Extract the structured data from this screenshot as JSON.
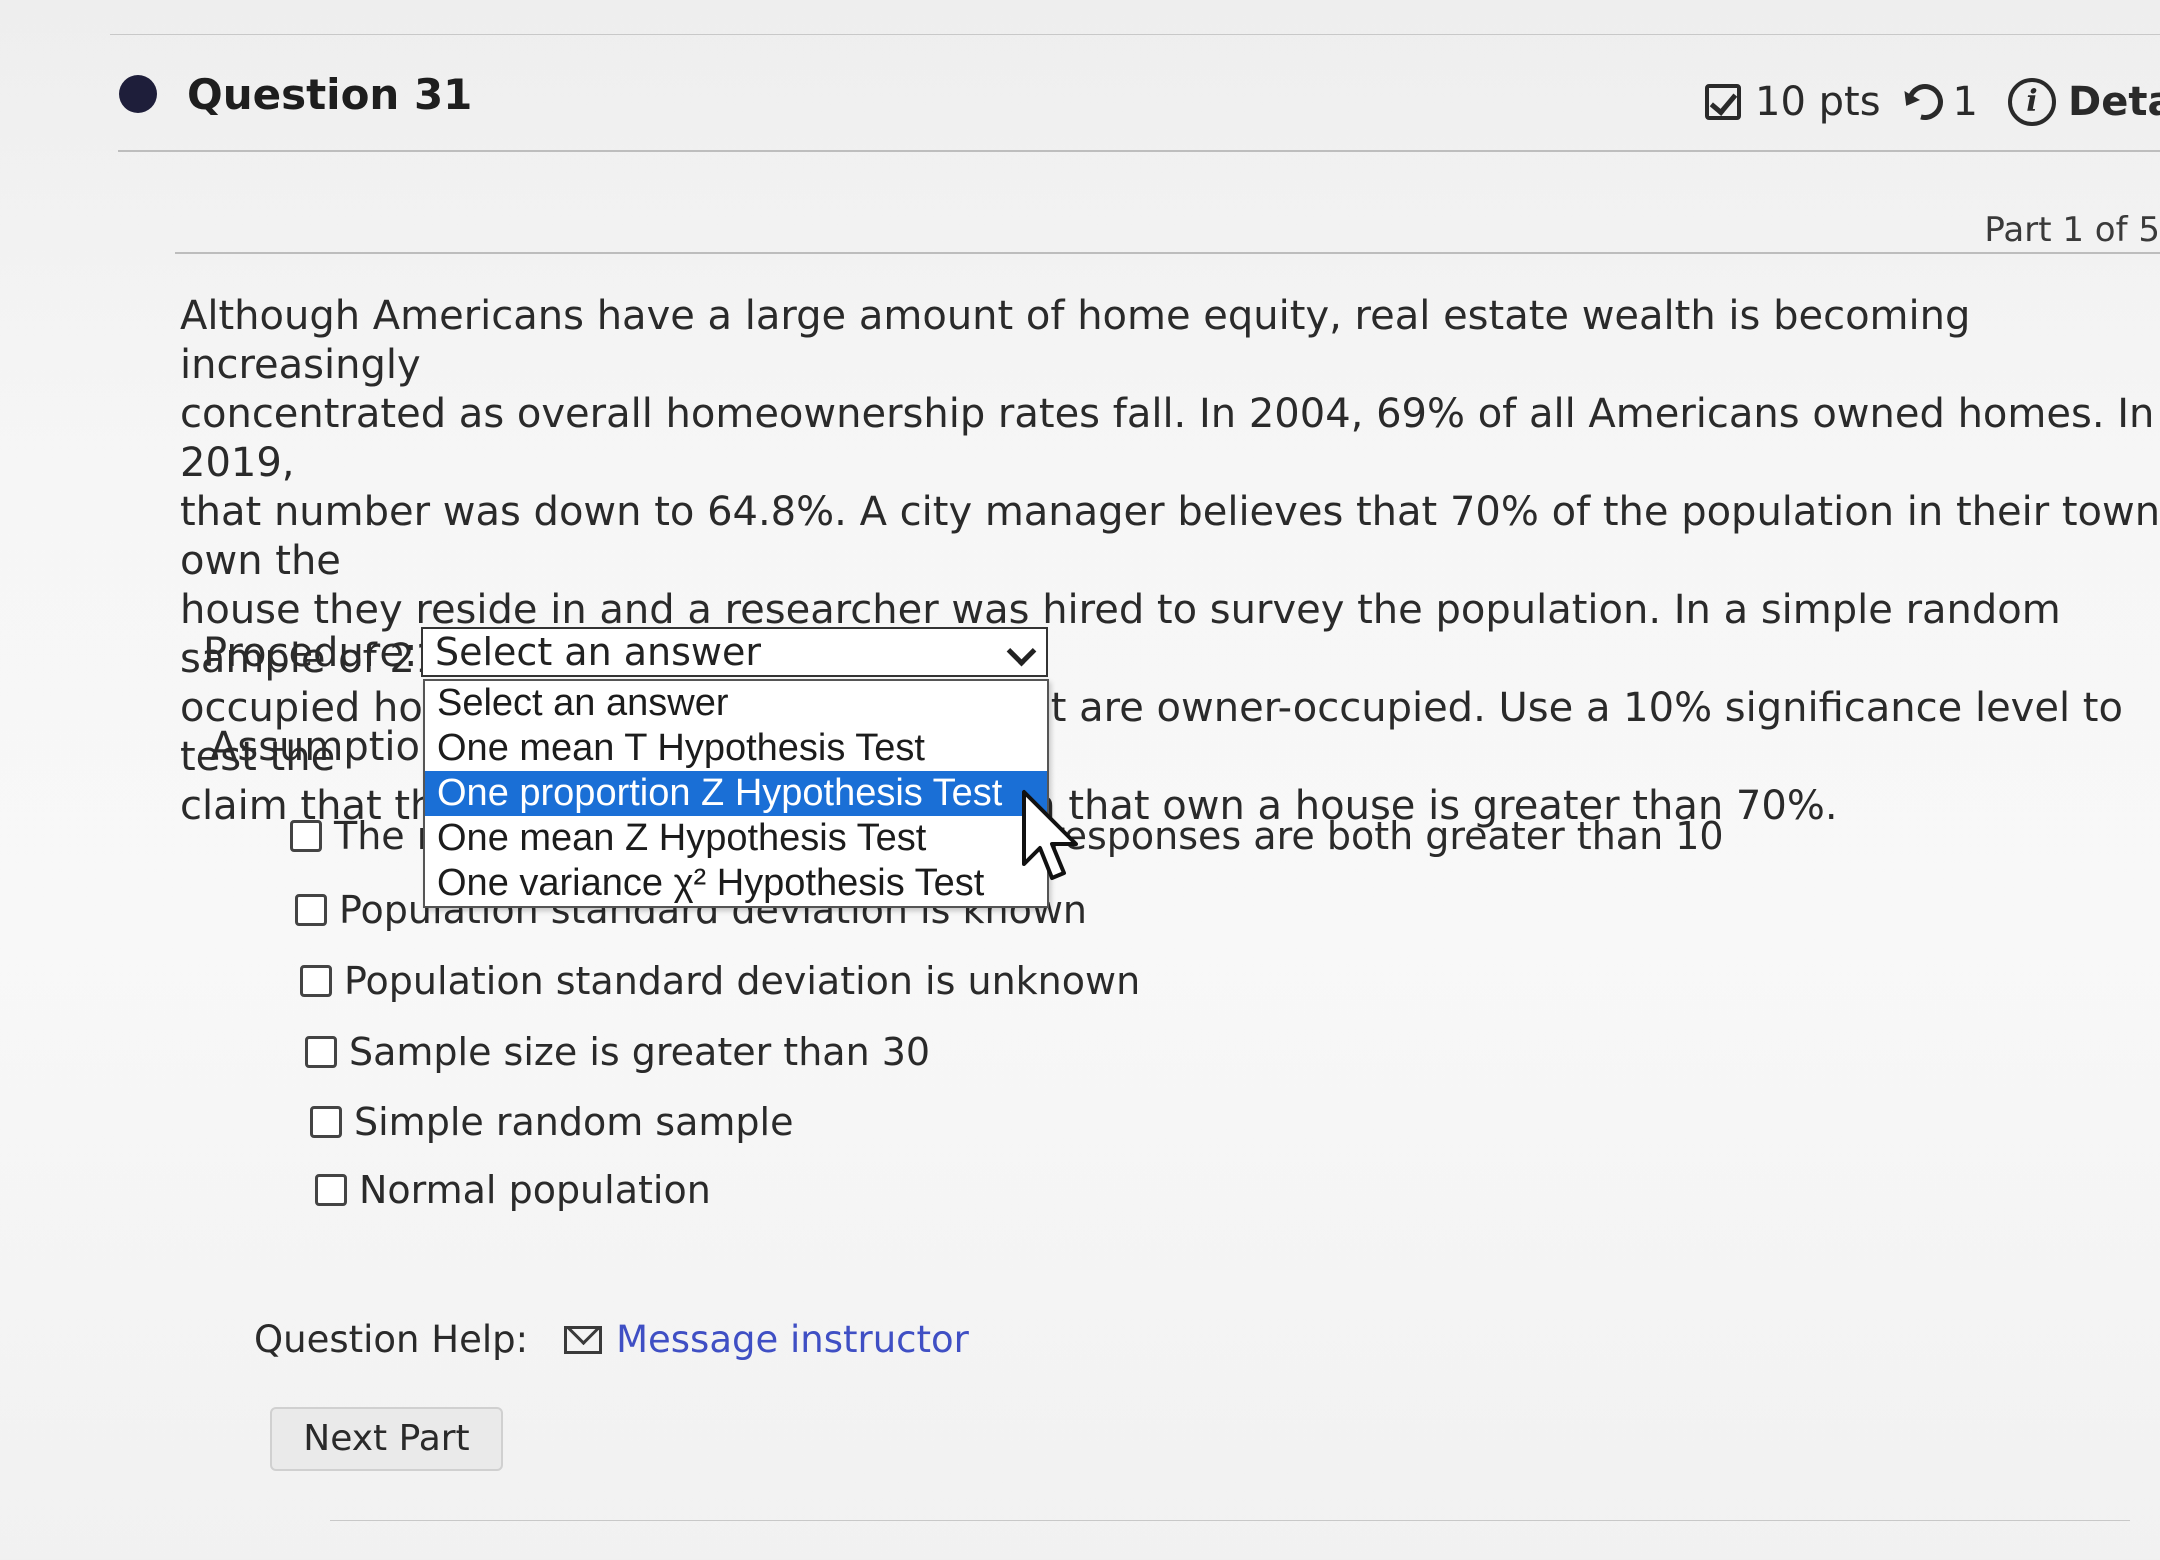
{
  "question": {
    "title": "Question 31",
    "points": "10 pts",
    "attempts": "1",
    "details": "Details",
    "part": "Part 1 of 5",
    "text": [
      "Although Americans have a large amount of home equity, real estate wealth is becoming increasingly",
      "concentrated as overall homeownership rates fall. In 2004, 69% of all Americans owned homes. In 2019,",
      "that number was down to 64.8%. A city manager believes that 70% of the population in their town own the",
      "house they reside in and a researcher was hired to survey the population. In a simple random sample of 210",
      "occupied housing units, there were 154 that are owner-occupied. Use a 10% significance level to test the",
      "claim that the percentage of the population that own a house is greater than 70%."
    ]
  },
  "procedure": {
    "label": "Procedure:",
    "selected": "Select an answer",
    "options": [
      "Select an answer",
      "One mean T Hypothesis Test",
      "One proportion Z Hypothesis Test",
      "One mean Z Hypothesis Test",
      "One variance χ² Hypothesis Test"
    ],
    "highlighted_index": 2
  },
  "assumptions": {
    "label": "Assumptions:",
    "items": [
      "The number of positive and negative responses are both greater than 10",
      "Population standard deviation is known",
      "Population standard deviation is unknown",
      "Sample size is greater than 30",
      "Simple random sample",
      "Normal population"
    ]
  },
  "help": {
    "label": "Question Help:",
    "link": "Message instructor"
  },
  "next_button": "Next Part",
  "colors": {
    "highlight": "#1a6fd6",
    "link": "#3f4fc4",
    "bullet": "#1e1e3a"
  }
}
